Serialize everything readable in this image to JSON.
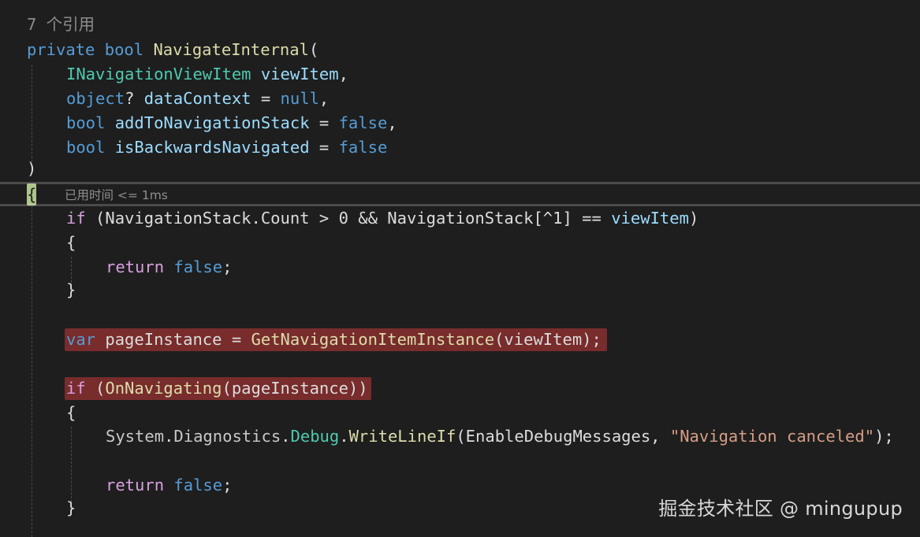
{
  "editor": {
    "reference_count": "7 个引用",
    "signature": {
      "modifier": "private",
      "return_type": "bool",
      "method_name": "NavigateInternal",
      "open_paren": "(",
      "close_paren": ")",
      "params": [
        {
          "type": "INavigationViewItem",
          "name": "viewItem",
          "suffix": ","
        },
        {
          "type": "object",
          "nullable": "?",
          "name": "dataContext",
          "eq": " = ",
          "default": "null",
          "suffix": ","
        },
        {
          "type": "bool",
          "name": "addToNavigationStack",
          "eq": " = ",
          "default": "false",
          "suffix": ","
        },
        {
          "type": "bool",
          "name": "isBackwardsNavigated",
          "eq": " = ",
          "default": "false",
          "suffix": ""
        }
      ]
    },
    "open_brace": "{",
    "close_brace": "}",
    "timing_hint": "已用时间 <= 1ms",
    "line_if1": {
      "kw": "if",
      "part1": " (NavigationStack.Count ",
      "gt": ">",
      "part2": " 0 ",
      "and": "&&",
      "part3": " NavigationStack[",
      "hat": "^",
      "part4": "1] ",
      "eq": "==",
      "space": " ",
      "param": "viewItem",
      "end": ")"
    },
    "return_false": {
      "kw": "return",
      "space": " ",
      "val": "false",
      "end": ";"
    },
    "line_var": {
      "kw": "var",
      "part1": " pageInstance = ",
      "method": "GetNavigationItemInstance",
      "part2": "(viewItem);"
    },
    "line_if2": {
      "kw": "if",
      "part1": " (",
      "method": "OnNavigating",
      "part2": "(pageInstance))"
    },
    "line_debug": {
      "ns1": "System",
      "dot1": ".",
      "ns2": "Diagnostics",
      "dot2": ".",
      "cls": "Debug",
      "dot3": ".",
      "method": "WriteLineIf",
      "part1": "(EnableDebugMessages, ",
      "str": "\"Navigation canceled\"",
      "end": ");"
    }
  },
  "watermark": "掘金技术社区 @ mingupup",
  "colors": {
    "background": "#1e1e1e",
    "keyword": "#569cd6",
    "control": "#d8a0df",
    "type": "#4ec9b0",
    "method": "#dcdcaa",
    "param": "#9cdcfe",
    "string": "#d69d85",
    "highlight": "#782c2c",
    "brace_match": "#c8e3a0"
  }
}
